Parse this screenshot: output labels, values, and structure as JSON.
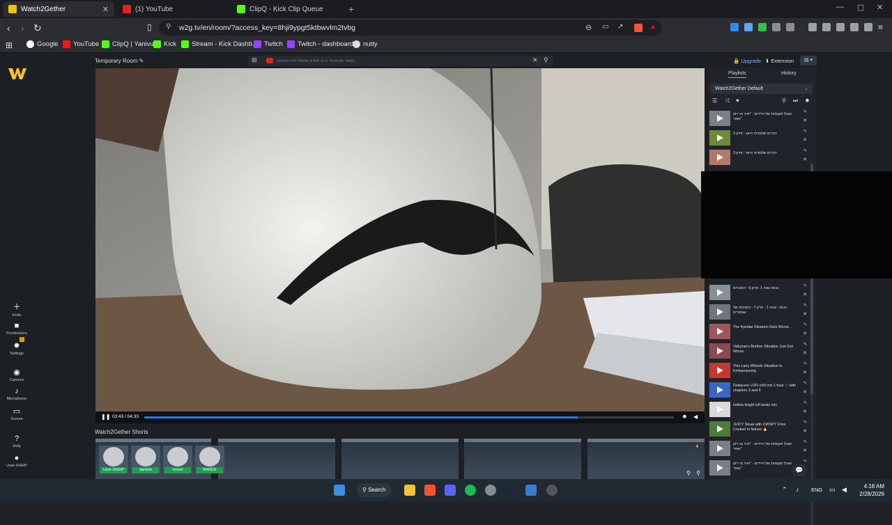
{
  "browser": {
    "tabs": [
      {
        "title": "Watch2Gether",
        "active": true
      },
      {
        "title": "(1) YouTube",
        "active": false
      },
      {
        "title": "ClipQ - Kick Clip Queue",
        "active": false
      }
    ],
    "url": "w2g.tv/en/room/?access_key=8hji9ypgt5ktbwvlm2tvbg",
    "bookmarks": [
      "Google",
      "YouTube",
      "ClipQ | Yanivu",
      "Kick",
      "Stream - Kick Dashb...",
      "Twitch",
      "Twitch - dashboard",
      "nutty"
    ]
  },
  "room": {
    "title": "Temporary Room",
    "search_placeholder": "Search OR Paste a link to a Youtube video",
    "upgrade": "Upgrade",
    "extension": "Extension",
    "time": "03:43 / 04:33",
    "progress": 0.818,
    "shorts_title": "Watch2Gether Shorts",
    "shorts_badge": "4"
  },
  "sidebar": {
    "invite": "Invite",
    "permissions": "Permissions",
    "settings": "Settings",
    "settings_badge": "!",
    "camera": "Camera",
    "microphone": "Microphone",
    "screen": "Screen",
    "help": "Help",
    "user": "User-IXAHP"
  },
  "users": [
    "User-IXAHP",
    "darshin",
    "lorens",
    "RANCE"
  ],
  "playlist": {
    "tab_playlists": "Playlists",
    "tab_history": "History",
    "selected": "Watch2Gether Default",
    "items_top": [
      {
        "title": "שובל מקומות של חיידים - \"יאיר גוי רזון ואפר\"",
        "color": "#7a7f86"
      },
      {
        "title": "דברים שלמדתי היום - פרק 2",
        "color": "#6c8a3a"
      },
      {
        "title": "דברים שלמדתי היום - פרק 3",
        "color": "#b07a6a"
      }
    ],
    "items_bottom": [
      {
        "title": "גבוס עונה 1: פרק 6 - המבכים",
        "color": "#8a8f96"
      },
      {
        "title": "גבוס : עונה 1 - פרק 7 - הסכנות של עצמורים",
        "color": "#70757c"
      },
      {
        "title": "The Kyedae Situation Gets Worse..",
        "color": "#a0555a"
      },
      {
        "title": "Valkyrae's Brother Situation Just Got Worse",
        "color": "#8a4a50"
      },
      {
        "title": "This Larry Wheels Situation Is Embarrassing",
        "color": "#c23a2e"
      },
      {
        "title": "Deltarune LOFI chill mix 1 hour ♡ with chapters 3 and 4",
        "color": "#3a66c4"
      },
      {
        "title": "hollow knight lofi beats mix",
        "color": "#d9d9d9"
      },
      {
        "title": "JUICY Steak with CRISPY Fries Cooked in Nature 🔥",
        "color": "#4e7a3a"
      },
      {
        "title": "שובל מקומות של חיידים - \"יאיר גוי רזון ואפר\"",
        "color": "#7a7f86"
      },
      {
        "title": "שובל מקומות של חיידים - \"יאיר גוי רזון ואפר\"",
        "color": "#7a7f86"
      }
    ]
  },
  "taskbar": {
    "search": "Search",
    "lang": "ENG",
    "time": "4:18 AM",
    "date": "2/28/2026"
  }
}
